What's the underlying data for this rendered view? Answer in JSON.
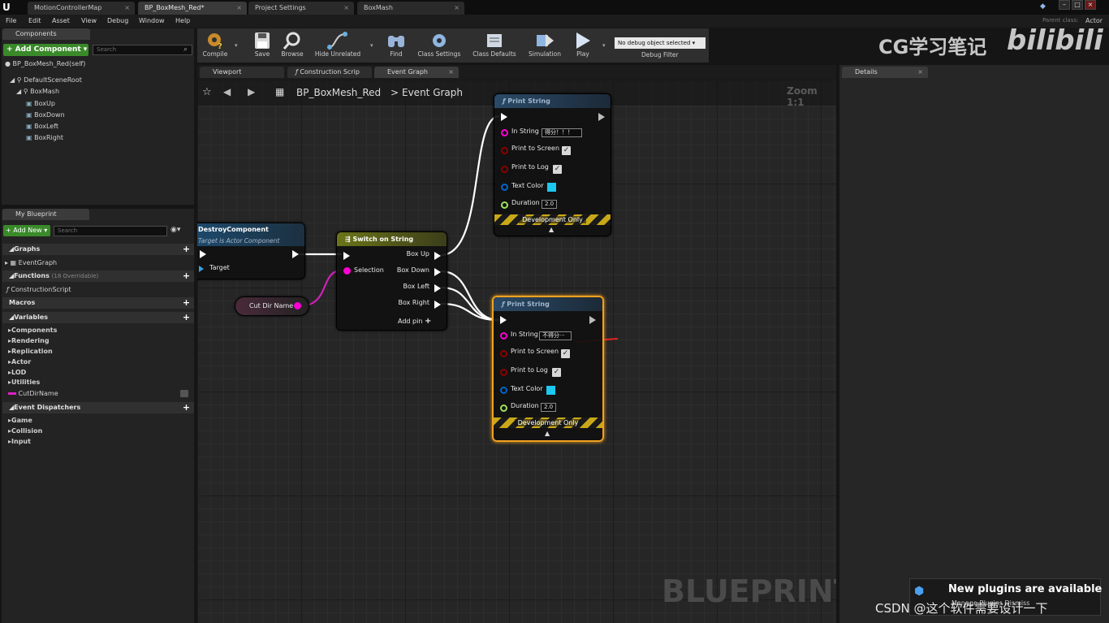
{
  "window": {
    "doc_tabs": [
      "MotionControllerMap",
      "BP_BoxMesh_Red*",
      "Project Settings",
      "BoxMash"
    ],
    "parent_class_label": "Parent class:",
    "parent_class_value": "Actor"
  },
  "menu": [
    "File",
    "Edit",
    "Asset",
    "View",
    "Debug",
    "Window",
    "Help"
  ],
  "components_panel": {
    "tab": "Components",
    "add_button": "+ Add Component ▾",
    "search_placeholder": "Search",
    "self_label": "BP_BoxMesh_Red(self)",
    "tree": [
      "DefaultSceneRoot",
      "BoxMash",
      "BoxUp",
      "BoxDown",
      "BoxLeft",
      "BoxRight"
    ]
  },
  "my_blueprint": {
    "tab": "My Blueprint",
    "add_button": "+ Add New ▾",
    "search_placeholder": "Search",
    "graphs_label": "Graphs",
    "event_graph": "EventGraph",
    "functions_label": "Functions",
    "functions_count": "(18 Overridable)",
    "construction_script": "ConstructionScript",
    "macros_label": "Macros",
    "variables_label": "Variables",
    "variable_categories": [
      "Components",
      "Rendering",
      "Replication",
      "Actor",
      "LOD",
      "Utilities"
    ],
    "variable_item": "CutDirName",
    "event_dispatchers_label": "Event Dispatchers",
    "dispatcher_categories": [
      "Game",
      "Collision",
      "Input"
    ]
  },
  "toolbar": {
    "buttons": [
      "Compile",
      "Save",
      "Browse",
      "Hide Unrelated",
      "Find",
      "Class Settings",
      "Class Defaults",
      "Simulation",
      "Play"
    ],
    "debug_select": "No debug object selected ▾",
    "debug_filter": "Debug Filter"
  },
  "editor_tabs": [
    "Viewport",
    "Construction Scrip",
    "Event Graph"
  ],
  "details_tab": "Details",
  "graph": {
    "breadcrumb_bp": "BP_BoxMesh_Red",
    "breadcrumb_sep": ">",
    "breadcrumb_graph": "Event Graph",
    "zoom": "Zoom 1:1",
    "watermark": "BLUEPRINT",
    "destroy_node": {
      "title": "DestroyComponent",
      "subtitle": "Target is Actor Component",
      "target_pin": "Target"
    },
    "cut_dir_node": {
      "label": "Cut Dir Name"
    },
    "switch_node": {
      "title": "Switch on String",
      "selection_pin": "Selection",
      "outputs": [
        "Box Up",
        "Box Down",
        "Box Left",
        "Box Right"
      ],
      "add_pin": "Add pin"
    },
    "print1": {
      "title": "Print String",
      "in_string_label": "In String",
      "in_string_value": "得分！！！",
      "print_to_screen": "Print to Screen",
      "print_to_log": "Print to Log",
      "text_color": "Text Color",
      "duration_label": "Duration",
      "duration_value": "2.0",
      "dev_only": "Development Only"
    },
    "print2": {
      "title": "Print String",
      "in_string_label": "In String",
      "in_string_value": "不得分···",
      "print_to_screen": "Print to Screen",
      "print_to_log": "Print to Log",
      "text_color": "Text Color",
      "duration_label": "Duration",
      "duration_value": "2.0",
      "dev_only": "Development Only"
    }
  },
  "overlays": {
    "brand_text": "CG学习笔记",
    "brand_logo": "bilibili",
    "notification": "New plugins are available",
    "notification_sub": "Manage Plugins  Dismiss",
    "csdn_watermark": "CSDN @这个软件需要设计一下"
  },
  "colors": {
    "exec_white": "#ffffff",
    "string_pin": "#ff00d4",
    "bool_pin": "#8b0000",
    "struct_pin": "#0066cc",
    "float_pin": "#a0e060",
    "text_color_swatch": "#1cc8f0",
    "selected_node": "#f0a020",
    "annotation_red": "#e82020"
  }
}
